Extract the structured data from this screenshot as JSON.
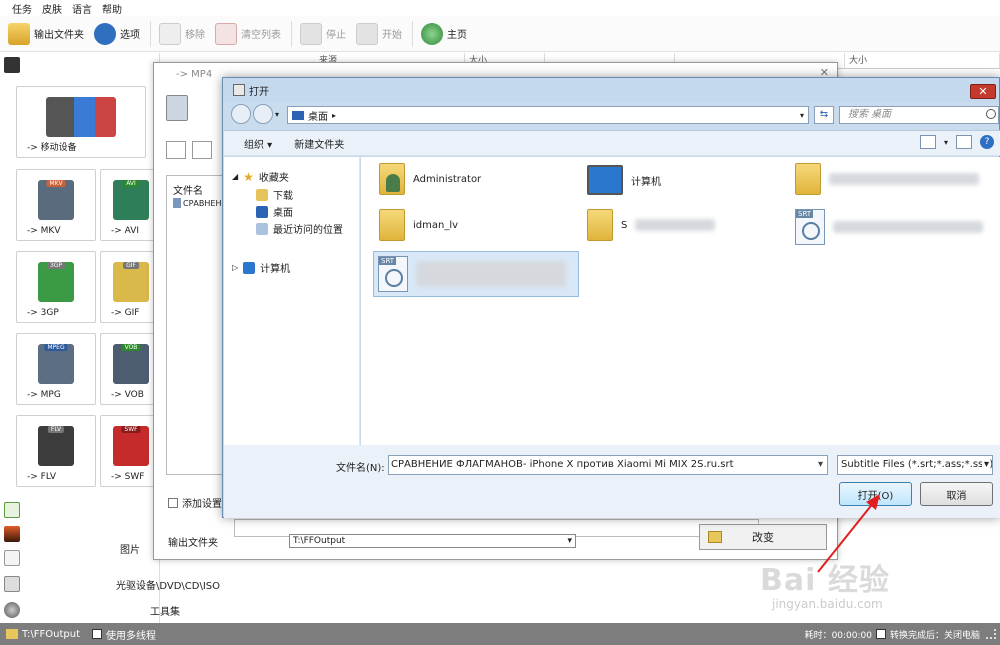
{
  "menubar": {
    "items": [
      "任务",
      "皮肤",
      "语言",
      "帮助"
    ]
  },
  "toolbar": {
    "output_folder": "输出文件夹",
    "options": "选项",
    "remove": "移除",
    "clear_list": "清空列表",
    "stop": "停止",
    "start": "开始",
    "home": "主页"
  },
  "left_panel": {
    "tiles": [
      {
        "label": "-> 移动设备"
      },
      {
        "label": "-> MKV",
        "badge": "MKV"
      },
      {
        "label": "-> AVI",
        "badge": "AVI"
      },
      {
        "label": "-> 3GP",
        "badge": "3GP"
      },
      {
        "label": "-> GIF",
        "badge": "GIF"
      },
      {
        "label": "-> MPG",
        "badge": "MPEG"
      },
      {
        "label": "-> VOB",
        "badge": "VOB"
      },
      {
        "label": "-> FLV",
        "badge": "FLV"
      },
      {
        "label": "-> SWF",
        "badge": "SWF"
      }
    ],
    "categories": {
      "pictures": "图片",
      "optical": "光驱设备\\DVD\\CD\\ISO",
      "toolbox": "工具集"
    }
  },
  "list_header": {
    "col_source": "来源",
    "col_size": "大小",
    "col_size2": "大小"
  },
  "mp4_dialog": {
    "title": "-> MP4",
    "file_list_header": "文件名",
    "file_row": "СРАВНЕН",
    "add_settings": "添加设置名",
    "output_folder_label": "输出文件夹",
    "output_path": "T:\\FFOutput",
    "change_button": "改变"
  },
  "open_dialog": {
    "title": "打开",
    "address": "桌面",
    "search_placeholder": "搜索 桌面",
    "organize": "组织 ▾",
    "new_folder": "新建文件夹",
    "nav": {
      "favorites": "收藏夹",
      "downloads": "下载",
      "desktop": "桌面",
      "recent": "最近访问的位置",
      "computer": "计算机"
    },
    "files": {
      "administrator": "Administrator",
      "computer": "计算机",
      "idman": "idman_lv",
      "s_item": "S"
    },
    "filename_label": "文件名(N):",
    "filename_value": "СРАВНЕНИЕ ФЛАГМАНОВ- iPhone X против Xiaomi Mi MIX 2S.ru.srt",
    "filter_value": "Subtitle Files (*.srt;*.ass;*.ssa)",
    "open_button": "打开(O)",
    "cancel_button": "取消"
  },
  "statusbar": {
    "output_path": "T:\\FFOutput",
    "multithread": "使用多线程",
    "elapsed": "耗时：00:00:00",
    "after_done": "转换完成后：关闭电脑"
  },
  "watermark": {
    "big": "Bai 经验",
    "small": "jingyan.baidu.com"
  },
  "colors": {
    "accent": "#3c7fb1",
    "close_red": "#c43b2d",
    "dialog_chrome": "#c9dcee",
    "statusbar": "#7d7d7d"
  }
}
